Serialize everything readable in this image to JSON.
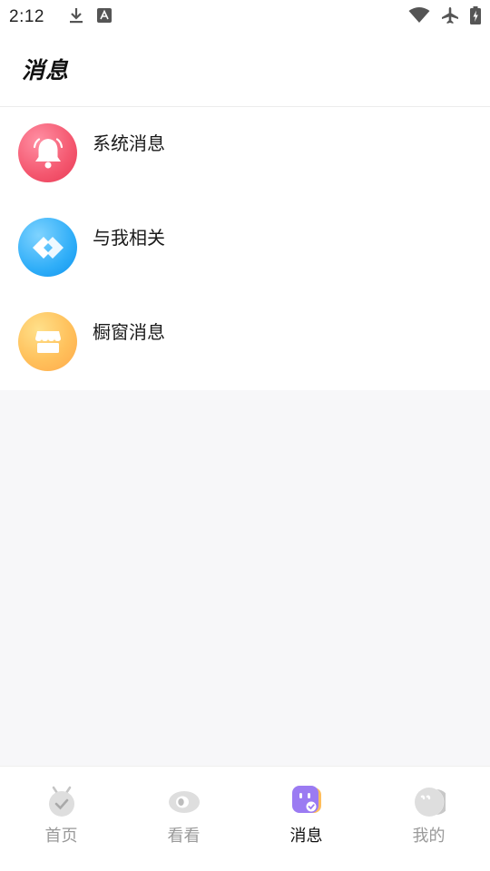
{
  "status_bar": {
    "time": "2:12",
    "left_icons": [
      "download-icon",
      "font-app-icon"
    ],
    "right_icons": [
      "wifi-icon",
      "airplane-icon",
      "battery-charging-icon"
    ]
  },
  "header": {
    "title": "消息"
  },
  "messages": [
    {
      "label": "系统消息",
      "icon": "bell-icon",
      "color": "#f4576f"
    },
    {
      "label": "与我相关",
      "icon": "link-chain-icon",
      "color": "#30aef8"
    },
    {
      "label": "橱窗消息",
      "icon": "storefront-icon",
      "color": "#ffb550"
    }
  ],
  "tabs": [
    {
      "label": "首页",
      "icon": "home-alarm-icon",
      "active": false
    },
    {
      "label": "看看",
      "icon": "eye-icon",
      "active": false
    },
    {
      "label": "消息",
      "icon": "message-face-icon",
      "active": true,
      "color": "#9b7bf2"
    },
    {
      "label": "我的",
      "icon": "profile-face-icon",
      "active": false
    }
  ]
}
